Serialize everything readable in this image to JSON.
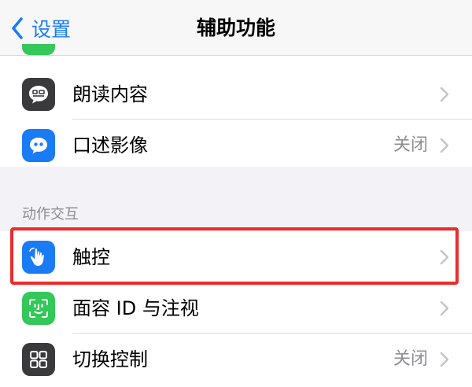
{
  "navbar": {
    "back_label": "设置",
    "title": "辅助功能"
  },
  "group1": {
    "items": [
      {
        "label": "朗读内容",
        "value": "",
        "icon": "speak-content-icon",
        "icon_color": "#3a3a3c"
      },
      {
        "label": "口述影像",
        "value": "关闭",
        "icon": "audio-description-icon",
        "icon_color": "#1a7cf5"
      }
    ]
  },
  "section": {
    "header": "动作交互"
  },
  "group2": {
    "items": [
      {
        "label": "触控",
        "value": "",
        "icon": "touch-hand-icon",
        "icon_color": "#1a7cf5"
      },
      {
        "label": "面容 ID 与注视",
        "value": "",
        "icon": "face-id-icon",
        "icon_color": "#34c759"
      },
      {
        "label": "切换控制",
        "value": "关闭",
        "icon": "switch-control-icon",
        "icon_color": "#3a3a3c"
      }
    ]
  },
  "colors": {
    "accent": "#1a7cf5",
    "highlight": "#ec2b2b",
    "background": "#f2f2f7"
  }
}
